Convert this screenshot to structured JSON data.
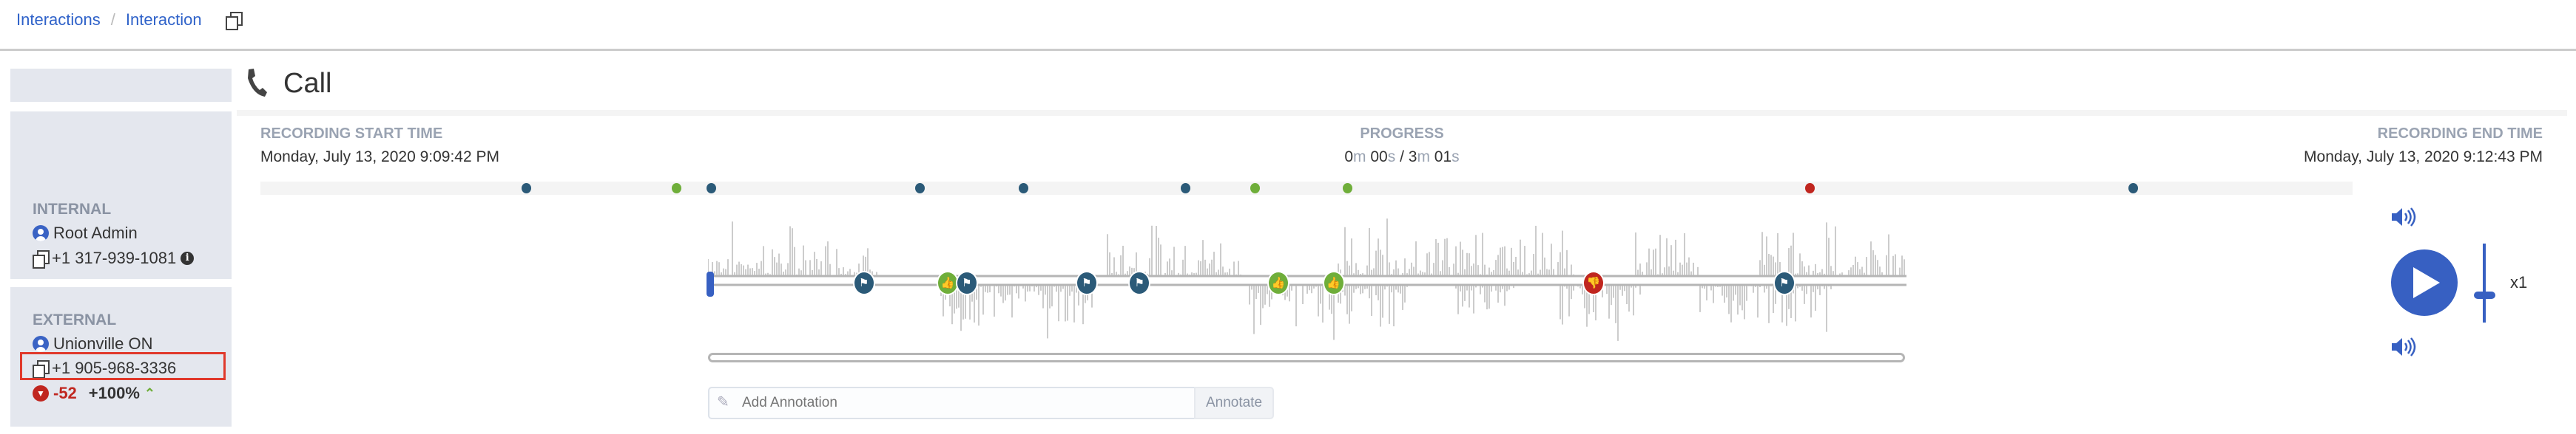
{
  "breadcrumb": {
    "items": [
      "Interactions",
      "Interaction"
    ],
    "separator": "/"
  },
  "left_panel": {
    "internal": {
      "label": "INTERNAL",
      "name": "Root Admin",
      "phone": "+1 317-939-1081"
    },
    "external": {
      "label": "EXTERNAL",
      "name": "Unionville ON",
      "phone": "+1 905-968-3336",
      "sentiment_score": "-52",
      "sentiment_change": "+100%"
    }
  },
  "header": {
    "title": "Call",
    "icon": "phone-icon"
  },
  "recording": {
    "start_label": "RECORDING START TIME",
    "start_time": "Monday, July 13, 2020 9:09:42 PM",
    "progress_label": "PROGRESS",
    "progress": {
      "cur_m": "0",
      "cur_s": "00",
      "sep": " / ",
      "tot_m": "3",
      "tot_s": "01",
      "m": "m",
      "s": "s"
    },
    "end_label": "RECORDING END TIME",
    "end_time": "Monday, July 13, 2020 9:12:43 PM",
    "duration_seconds": 181,
    "timeline_events_seconds": [
      {
        "t": 23,
        "type": "bookmark"
      },
      {
        "t": 36,
        "type": "positive"
      },
      {
        "t": 39,
        "type": "bookmark"
      },
      {
        "t": 57,
        "type": "bookmark"
      },
      {
        "t": 66,
        "type": "bookmark"
      },
      {
        "t": 80,
        "type": "bookmark"
      },
      {
        "t": 86,
        "type": "positive"
      },
      {
        "t": 94,
        "type": "positive"
      },
      {
        "t": 134,
        "type": "negative"
      },
      {
        "t": 162,
        "type": "bookmark"
      }
    ]
  },
  "waveform_markers": [
    {
      "type": "bookmark",
      "pos": 0.13
    },
    {
      "type": "positive",
      "pos": 0.2
    },
    {
      "type": "bookmark",
      "pos": 0.216
    },
    {
      "type": "bookmark",
      "pos": 0.316
    },
    {
      "type": "bookmark",
      "pos": 0.36
    },
    {
      "type": "positive",
      "pos": 0.476
    },
    {
      "type": "positive",
      "pos": 0.522
    },
    {
      "type": "negative",
      "pos": 0.739
    },
    {
      "type": "bookmark",
      "pos": 0.898
    }
  ],
  "annotation": {
    "placeholder": "Add Annotation",
    "button": "Annotate"
  },
  "player": {
    "speed": "x1",
    "speed_level": 0.35,
    "playback_progress": 0
  },
  "colors": {
    "bookmark": "#2b5a78",
    "positive": "#6fae3a",
    "negative": "#c0261f",
    "accent": "#3760c2"
  }
}
